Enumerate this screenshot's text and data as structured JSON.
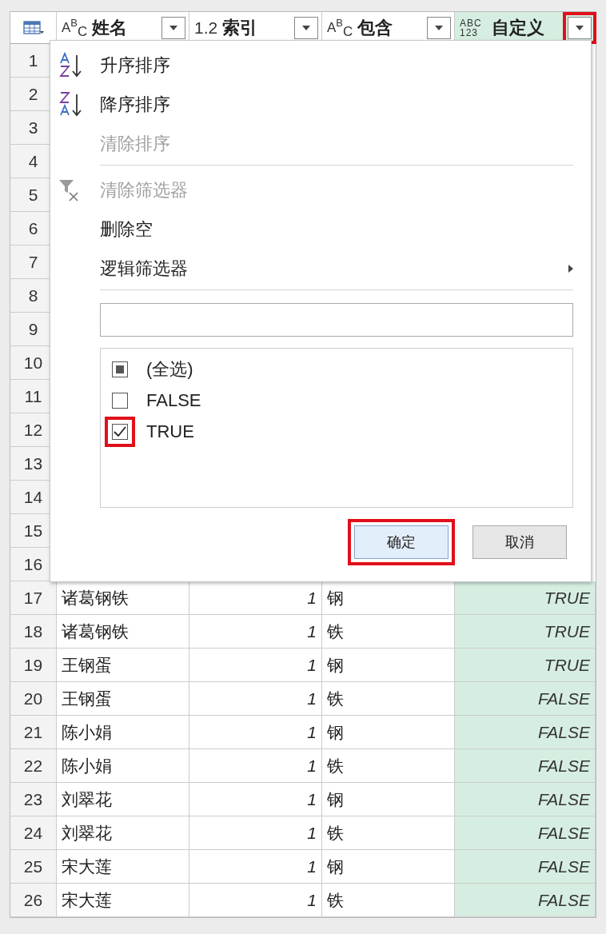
{
  "columns": [
    {
      "kind": "text",
      "type_label": "ABC",
      "name": "姓名",
      "dropdown_highlighted": false,
      "shaded": false
    },
    {
      "kind": "decimal",
      "type_label": "1.2",
      "name": "索引",
      "dropdown_highlighted": false,
      "shaded": false
    },
    {
      "kind": "text",
      "type_label": "ABC",
      "name": "包含",
      "dropdown_highlighted": false,
      "shaded": false
    },
    {
      "kind": "any",
      "type_label": "ABC 123",
      "name": "自定义",
      "dropdown_highlighted": true,
      "shaded": true
    }
  ],
  "rows": [
    {
      "number": "1"
    },
    {
      "number": "2"
    },
    {
      "number": "3"
    },
    {
      "number": "4"
    },
    {
      "number": "5"
    },
    {
      "number": "6"
    },
    {
      "number": "7"
    },
    {
      "number": "8"
    },
    {
      "number": "9"
    },
    {
      "number": "10"
    },
    {
      "number": "11"
    },
    {
      "number": "12"
    },
    {
      "number": "13"
    },
    {
      "number": "14"
    },
    {
      "number": "15"
    },
    {
      "number": "16"
    },
    {
      "number": "17",
      "cells": [
        "诸葛钢铁",
        "1",
        "钢",
        "TRUE"
      ]
    },
    {
      "number": "18",
      "cells": [
        "诸葛钢铁",
        "1",
        "铁",
        "TRUE"
      ]
    },
    {
      "number": "19",
      "cells": [
        "王钢蛋",
        "1",
        "钢",
        "TRUE"
      ]
    },
    {
      "number": "20",
      "cells": [
        "王钢蛋",
        "1",
        "铁",
        "FALSE"
      ]
    },
    {
      "number": "21",
      "cells": [
        "陈小娟",
        "1",
        "钢",
        "FALSE"
      ]
    },
    {
      "number": "22",
      "cells": [
        "陈小娟",
        "1",
        "铁",
        "FALSE"
      ]
    },
    {
      "number": "23",
      "cells": [
        "刘翠花",
        "1",
        "钢",
        "FALSE"
      ]
    },
    {
      "number": "24",
      "cells": [
        "刘翠花",
        "1",
        "铁",
        "FALSE"
      ]
    },
    {
      "number": "25",
      "cells": [
        "宋大莲",
        "1",
        "钢",
        "FALSE"
      ]
    },
    {
      "number": "26",
      "cells": [
        "宋大莲",
        "1",
        "铁",
        "FALSE"
      ]
    }
  ],
  "filter_menu": {
    "menu_groups": [
      [
        {
          "kind": "sort-asc",
          "label": "升序排序",
          "disabled": false
        },
        {
          "kind": "sort-desc",
          "label": "降序排序",
          "disabled": false
        },
        {
          "kind": "plain",
          "label": "清除排序",
          "disabled": true
        }
      ],
      [
        {
          "kind": "clear-filter",
          "label": "清除筛选器",
          "disabled": true
        },
        {
          "kind": "plain",
          "label": "删除空",
          "disabled": false
        },
        {
          "kind": "submenu",
          "label": "逻辑筛选器",
          "disabled": false
        }
      ]
    ],
    "values": [
      {
        "label": "(全选)",
        "checked": false,
        "partial": true,
        "highlighted": false
      },
      {
        "label": "FALSE",
        "checked": false,
        "partial": false,
        "highlighted": false
      },
      {
        "label": "TRUE",
        "checked": true,
        "partial": false,
        "highlighted": true
      }
    ],
    "buttons": [
      {
        "label": "确定",
        "primary": true,
        "highlighted": true
      },
      {
        "label": "取消",
        "primary": false,
        "highlighted": false
      }
    ]
  }
}
